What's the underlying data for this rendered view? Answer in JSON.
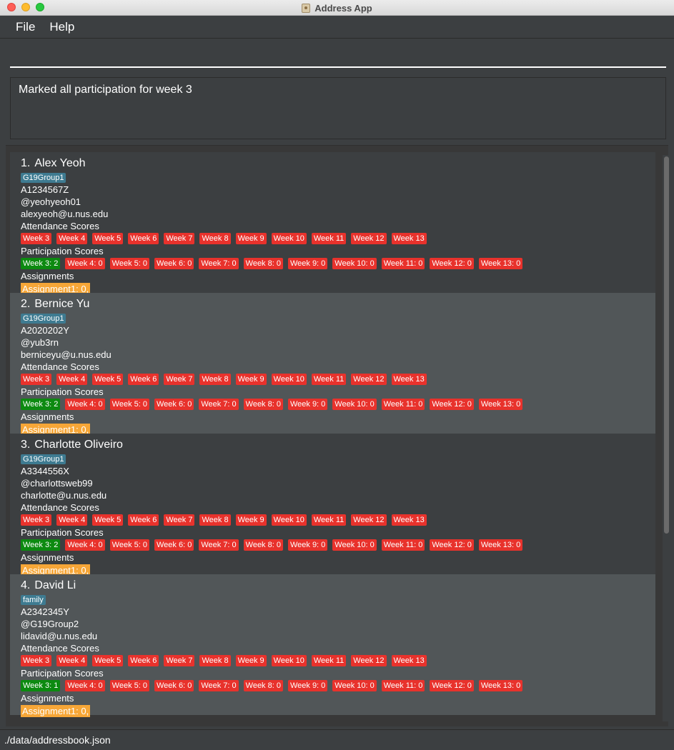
{
  "window": {
    "title": "Address App"
  },
  "menu": {
    "file": "File",
    "help": "Help"
  },
  "command": {
    "value": "",
    "placeholder": ""
  },
  "result": {
    "message": "Marked all participation for week 3"
  },
  "labels": {
    "attendance": "Attendance Scores",
    "participation": "Participation Scores",
    "assignments": "Assignments"
  },
  "persons": [
    {
      "index": "1.",
      "name": "Alex Yeoh",
      "tag": "G19Group1",
      "student_id": "A1234567Z",
      "telegram": "@yeohyeoh01",
      "email": "alexyeoh@u.nus.edu",
      "attendance": [
        "Week 3",
        "Week 4",
        "Week 5",
        "Week 6",
        "Week 7",
        "Week 8",
        "Week 9",
        "Week 10",
        "Week 11",
        "Week 12",
        "Week 13"
      ],
      "participation": [
        "Week 3: 2",
        "Week 4: 0",
        "Week 5: 0",
        "Week 6: 0",
        "Week 7: 0",
        "Week 8: 0",
        "Week 9: 0",
        "Week 10: 0",
        "Week 11: 0",
        "Week 12: 0",
        "Week 13: 0"
      ],
      "assignments": "Assignment1: 0,"
    },
    {
      "index": "2.",
      "name": "Bernice Yu",
      "tag": "G19Group1",
      "student_id": "A2020202Y",
      "telegram": "@yub3rn",
      "email": "berniceyu@u.nus.edu",
      "attendance": [
        "Week 3",
        "Week 4",
        "Week 5",
        "Week 6",
        "Week 7",
        "Week 8",
        "Week 9",
        "Week 10",
        "Week 11",
        "Week 12",
        "Week 13"
      ],
      "participation": [
        "Week 3: 2",
        "Week 4: 0",
        "Week 5: 0",
        "Week 6: 0",
        "Week 7: 0",
        "Week 8: 0",
        "Week 9: 0",
        "Week 10: 0",
        "Week 11: 0",
        "Week 12: 0",
        "Week 13: 0"
      ],
      "assignments": "Assignment1: 0,"
    },
    {
      "index": "3.",
      "name": "Charlotte Oliveiro",
      "tag": "G19Group1",
      "student_id": "A3344556X",
      "telegram": "@charlottsweb99",
      "email": "charlotte@u.nus.edu",
      "attendance": [
        "Week 3",
        "Week 4",
        "Week 5",
        "Week 6",
        "Week 7",
        "Week 8",
        "Week 9",
        "Week 10",
        "Week 11",
        "Week 12",
        "Week 13"
      ],
      "participation": [
        "Week 3: 2",
        "Week 4: 0",
        "Week 5: 0",
        "Week 6: 0",
        "Week 7: 0",
        "Week 8: 0",
        "Week 9: 0",
        "Week 10: 0",
        "Week 11: 0",
        "Week 12: 0",
        "Week 13: 0"
      ],
      "assignments": "Assignment1: 0,"
    },
    {
      "index": "4.",
      "name": "David Li",
      "tag": "family",
      "student_id": "A2342345Y",
      "telegram": "@G19Group2",
      "email": "lidavid@u.nus.edu",
      "attendance": [
        "Week 3",
        "Week 4",
        "Week 5",
        "Week 6",
        "Week 7",
        "Week 8",
        "Week 9",
        "Week 10",
        "Week 11",
        "Week 12",
        "Week 13"
      ],
      "participation": [
        "Week 3: 1",
        "Week 4: 0",
        "Week 5: 0",
        "Week 6: 0",
        "Week 7: 0",
        "Week 8: 0",
        "Week 9: 0",
        "Week 10: 0",
        "Week 11: 0",
        "Week 12: 0",
        "Week 13: 0"
      ],
      "assignments": "Assignment1: 0,"
    }
  ],
  "status": {
    "path": "./data/addressbook.json"
  },
  "colors": {
    "background": "#3c3f41",
    "card_alt": "#515658",
    "tag": "#3e7b91",
    "absent_chip": "#e8322c",
    "participated_chip": "#0c8a10",
    "assignment": "#f6a637"
  }
}
